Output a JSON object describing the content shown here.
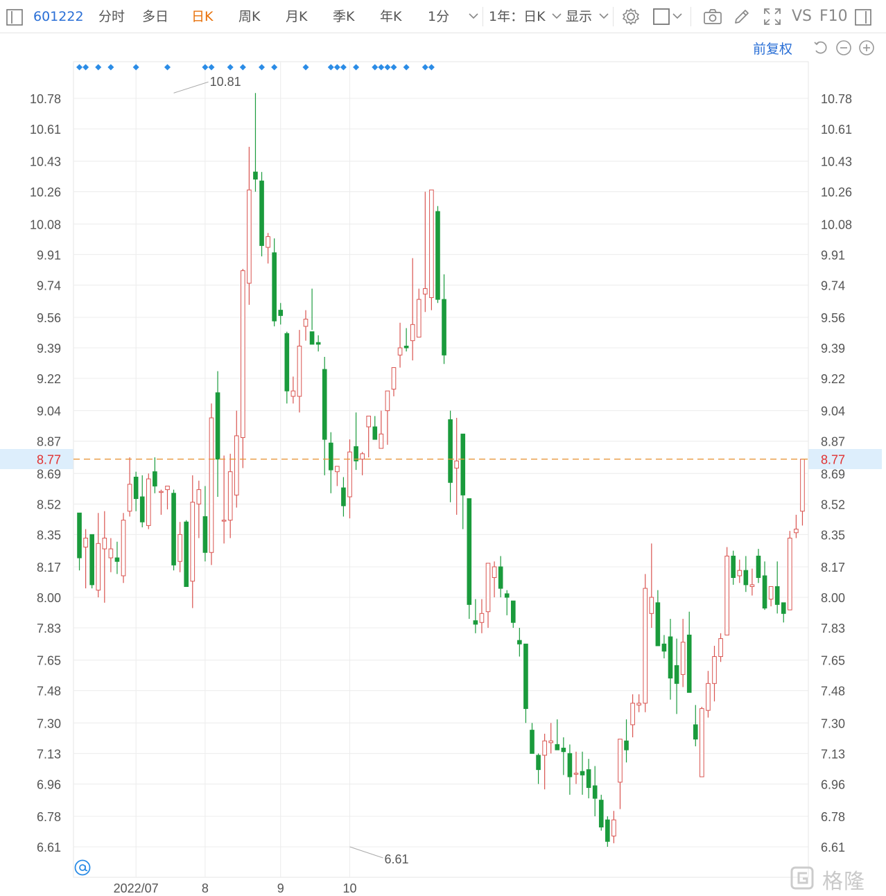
{
  "toolbar": {
    "code": "601222",
    "periods": [
      "分时",
      "多日",
      "日K",
      "周K",
      "月K",
      "季K",
      "年K",
      "1分"
    ],
    "active_period": "日K",
    "range_label": "1年：日K",
    "display_label": "显示",
    "vs_label": "VS",
    "f10_label": "F10"
  },
  "subbar": {
    "adjust_label": "前复权"
  },
  "watermark": "格隆汇",
  "icons": {
    "sidebar-toggle": "sidebar-icon",
    "settings": "gear-icon",
    "box": "square-icon",
    "camera": "camera-icon",
    "draw": "pencil-icon",
    "fullscreen": "fullscreen-icon",
    "panel": "panel-icon",
    "undo": "undo-icon",
    "zoom_out": "zoom-out-icon",
    "zoom_in": "zoom-in-icon",
    "at": "at-icon"
  },
  "colors": {
    "up": "#d9534f",
    "down": "#1a9b3c",
    "current_line": "#e8963a",
    "current_text": "#e03030",
    "marker": "#2b8ce6",
    "accent": "#e8710a",
    "link": "#2a6fd6"
  },
  "chart_data": {
    "type": "candlestick",
    "yticks": [
      "10.78",
      "10.61",
      "10.43",
      "10.26",
      "10.08",
      "9.91",
      "9.74",
      "9.56",
      "9.39",
      "9.22",
      "9.04",
      "8.87",
      "8.69",
      "8.52",
      "8.35",
      "8.17",
      "8.00",
      "7.83",
      "7.65",
      "7.48",
      "7.30",
      "7.13",
      "6.96",
      "6.78",
      "6.61"
    ],
    "ylim": [
      6.61,
      10.78
    ],
    "x_labels": [
      {
        "label": "2022/07",
        "index": 9
      },
      {
        "label": "8",
        "index": 20
      },
      {
        "label": "9",
        "index": 32
      },
      {
        "label": "10",
        "index": 43
      }
    ],
    "current_price": 8.77,
    "annotations": [
      {
        "label": "10.81",
        "index": 15,
        "price": 10.81
      },
      {
        "label": "6.61",
        "index": 43,
        "price": 6.61
      }
    ],
    "marker_indices": [
      0,
      1,
      3,
      5,
      9,
      14,
      20,
      21,
      24,
      26,
      29,
      31,
      36,
      40,
      41,
      42,
      44,
      47,
      48,
      49,
      50,
      52,
      55,
      56
    ],
    "candles": [
      {
        "o": 8.47,
        "h": 8.47,
        "l": 8.15,
        "c": 8.22
      },
      {
        "o": 8.28,
        "h": 8.38,
        "l": 8.05,
        "c": 8.33
      },
      {
        "o": 8.35,
        "h": 8.35,
        "l": 8.05,
        "c": 8.07
      },
      {
        "o": 8.04,
        "h": 8.47,
        "l": 8.0,
        "c": 8.3
      },
      {
        "o": 8.27,
        "h": 8.48,
        "l": 7.97,
        "c": 8.33
      },
      {
        "o": 8.22,
        "h": 8.33,
        "l": 8.14,
        "c": 8.27
      },
      {
        "o": 8.22,
        "h": 8.31,
        "l": 8.13,
        "c": 8.2
      },
      {
        "o": 8.12,
        "h": 8.47,
        "l": 8.08,
        "c": 8.43
      },
      {
        "o": 8.48,
        "h": 8.78,
        "l": 8.45,
        "c": 8.63
      },
      {
        "o": 8.67,
        "h": 8.7,
        "l": 8.48,
        "c": 8.55
      },
      {
        "o": 8.56,
        "h": 8.68,
        "l": 8.39,
        "c": 8.42
      },
      {
        "o": 8.4,
        "h": 8.69,
        "l": 8.38,
        "c": 8.66
      },
      {
        "o": 8.7,
        "h": 8.78,
        "l": 8.58,
        "c": 8.62
      },
      {
        "o": 8.59,
        "h": 8.6,
        "l": 8.46,
        "c": 8.59
      },
      {
        "o": 8.6,
        "h": 8.62,
        "l": 8.49,
        "c": 8.62
      },
      {
        "o": 8.58,
        "h": 8.6,
        "l": 8.15,
        "c": 8.18
      },
      {
        "o": 8.2,
        "h": 8.42,
        "l": 8.14,
        "c": 8.35
      },
      {
        "o": 8.42,
        "h": 8.43,
        "l": 8.06,
        "c": 8.06
      },
      {
        "o": 8.09,
        "h": 8.68,
        "l": 7.94,
        "c": 8.53
      },
      {
        "o": 8.52,
        "h": 8.65,
        "l": 8.33,
        "c": 8.6
      },
      {
        "o": 8.45,
        "h": 8.62,
        "l": 8.2,
        "c": 8.25
      },
      {
        "o": 8.25,
        "h": 9.08,
        "l": 8.18,
        "c": 9.0
      },
      {
        "o": 9.14,
        "h": 9.26,
        "l": 8.56,
        "c": 8.77
      },
      {
        "o": 8.43,
        "h": 8.79,
        "l": 8.3,
        "c": 8.43
      },
      {
        "o": 8.43,
        "h": 8.8,
        "l": 8.33,
        "c": 8.7
      },
      {
        "o": 8.57,
        "h": 9.04,
        "l": 8.5,
        "c": 8.9
      },
      {
        "o": 8.89,
        "h": 9.83,
        "l": 8.72,
        "c": 9.82
      },
      {
        "o": 9.75,
        "h": 10.51,
        "l": 9.63,
        "c": 10.27
      },
      {
        "o": 10.37,
        "h": 10.81,
        "l": 10.26,
        "c": 10.33
      },
      {
        "o": 10.32,
        "h": 10.37,
        "l": 9.9,
        "c": 9.96
      },
      {
        "o": 9.95,
        "h": 10.03,
        "l": 9.86,
        "c": 10.01
      },
      {
        "o": 9.92,
        "h": 10.0,
        "l": 9.51,
        "c": 9.54
      },
      {
        "o": 9.6,
        "h": 9.64,
        "l": 9.52,
        "c": 9.57
      },
      {
        "o": 9.47,
        "h": 9.48,
        "l": 9.08,
        "c": 9.15
      },
      {
        "o": 9.12,
        "h": 9.23,
        "l": 9.08,
        "c": 9.15
      },
      {
        "o": 9.12,
        "h": 9.49,
        "l": 9.03,
        "c": 9.4
      },
      {
        "o": 9.51,
        "h": 9.6,
        "l": 9.43,
        "c": 9.55
      },
      {
        "o": 9.48,
        "h": 9.72,
        "l": 9.49,
        "c": 9.41
      },
      {
        "o": 9.42,
        "h": 9.46,
        "l": 9.37,
        "c": 9.41
      },
      {
        "o": 9.27,
        "h": 9.34,
        "l": 8.68,
        "c": 8.88
      },
      {
        "o": 8.86,
        "h": 8.92,
        "l": 8.58,
        "c": 8.71
      },
      {
        "o": 8.7,
        "h": 8.73,
        "l": 8.62,
        "c": 8.73
      },
      {
        "o": 8.61,
        "h": 8.67,
        "l": 8.45,
        "c": 8.51
      },
      {
        "o": 8.56,
        "h": 8.88,
        "l": 8.44,
        "c": 8.81
      },
      {
        "o": 8.84,
        "h": 9.03,
        "l": 8.71,
        "c": 8.76
      },
      {
        "o": 8.77,
        "h": 8.81,
        "l": 8.68,
        "c": 8.8
      },
      {
        "o": 8.95,
        "h": 8.99,
        "l": 8.78,
        "c": 9.01
      },
      {
        "o": 8.95,
        "h": 9.01,
        "l": 8.93,
        "c": 8.88
      },
      {
        "o": 8.83,
        "h": 9.04,
        "l": 8.83,
        "c": 8.91
      },
      {
        "o": 9.04,
        "h": 9.12,
        "l": 8.85,
        "c": 9.15
      },
      {
        "o": 9.16,
        "h": 9.22,
        "l": 9.12,
        "c": 9.28
      },
      {
        "o": 9.35,
        "h": 9.53,
        "l": 9.28,
        "c": 9.39
      },
      {
        "o": 9.4,
        "h": 9.5,
        "l": 9.37,
        "c": 9.39
      },
      {
        "o": 9.43,
        "h": 9.89,
        "l": 9.32,
        "c": 9.52
      },
      {
        "o": 9.45,
        "h": 9.72,
        "l": 9.45,
        "c": 9.66
      },
      {
        "o": 9.69,
        "h": 10.26,
        "l": 9.59,
        "c": 9.72
      },
      {
        "o": 9.67,
        "h": 10.27,
        "l": 9.6,
        "c": 10.27
      },
      {
        "o": 10.15,
        "h": 10.18,
        "l": 9.64,
        "c": 9.66
      },
      {
        "o": 9.66,
        "h": 9.8,
        "l": 9.3,
        "c": 9.35
      },
      {
        "o": 8.99,
        "h": 9.04,
        "l": 8.53,
        "c": 8.64
      },
      {
        "o": 8.72,
        "h": 9.0,
        "l": 8.46,
        "c": 8.76
      },
      {
        "o": 8.91,
        "h": 8.91,
        "l": 8.38,
        "c": 8.57
      },
      {
        "o": 8.55,
        "h": 8.55,
        "l": 7.88,
        "c": 7.96
      },
      {
        "o": 7.87,
        "h": 7.99,
        "l": 7.8,
        "c": 7.85
      },
      {
        "o": 7.86,
        "h": 7.99,
        "l": 7.8,
        "c": 7.91
      },
      {
        "o": 7.92,
        "h": 8.19,
        "l": 7.83,
        "c": 8.19
      },
      {
        "o": 8.11,
        "h": 8.2,
        "l": 8.0,
        "c": 8.17
      },
      {
        "o": 8.17,
        "h": 8.23,
        "l": 8.0,
        "c": 8.05
      },
      {
        "o": 8.02,
        "h": 8.04,
        "l": 7.9,
        "c": 8.0
      },
      {
        "o": 7.98,
        "h": 7.98,
        "l": 7.83,
        "c": 7.86
      },
      {
        "o": 7.76,
        "h": 7.83,
        "l": 7.67,
        "c": 7.74
      },
      {
        "o": 7.74,
        "h": 7.74,
        "l": 7.3,
        "c": 7.38
      },
      {
        "o": 7.26,
        "h": 7.3,
        "l": 7.14,
        "c": 7.13
      },
      {
        "o": 7.12,
        "h": 7.13,
        "l": 6.96,
        "c": 7.04
      },
      {
        "o": 7.12,
        "h": 7.24,
        "l": 6.93,
        "c": 7.2
      },
      {
        "o": 7.19,
        "h": 7.3,
        "l": 7.13,
        "c": 7.2
      },
      {
        "o": 7.18,
        "h": 7.32,
        "l": 7.16,
        "c": 7.15
      },
      {
        "o": 7.16,
        "h": 7.22,
        "l": 7.01,
        "c": 7.14
      },
      {
        "o": 7.13,
        "h": 7.18,
        "l": 6.9,
        "c": 7.0
      },
      {
        "o": 7.02,
        "h": 7.14,
        "l": 6.96,
        "c": 7.02
      },
      {
        "o": 7.03,
        "h": 7.14,
        "l": 6.9,
        "c": 7.01
      },
      {
        "o": 7.04,
        "h": 7.1,
        "l": 6.88,
        "c": 6.94
      },
      {
        "o": 6.95,
        "h": 7.06,
        "l": 6.78,
        "c": 6.88
      },
      {
        "o": 6.87,
        "h": 6.9,
        "l": 6.7,
        "c": 6.72
      },
      {
        "o": 6.76,
        "h": 6.78,
        "l": 6.61,
        "c": 6.64
      },
      {
        "o": 6.67,
        "h": 6.81,
        "l": 6.63,
        "c": 6.76
      },
      {
        "o": 6.97,
        "h": 7.19,
        "l": 6.82,
        "c": 7.21
      },
      {
        "o": 7.2,
        "h": 7.32,
        "l": 7.08,
        "c": 7.15
      },
      {
        "o": 7.29,
        "h": 7.46,
        "l": 7.22,
        "c": 7.41
      },
      {
        "o": 7.4,
        "h": 7.46,
        "l": 7.36,
        "c": 7.41
      },
      {
        "o": 7.41,
        "h": 8.13,
        "l": 7.36,
        "c": 8.05
      },
      {
        "o": 7.91,
        "h": 8.3,
        "l": 7.83,
        "c": 8.0
      },
      {
        "o": 7.97,
        "h": 8.04,
        "l": 7.76,
        "c": 7.73
      },
      {
        "o": 7.74,
        "h": 7.79,
        "l": 7.66,
        "c": 7.7
      },
      {
        "o": 7.78,
        "h": 7.88,
        "l": 7.43,
        "c": 7.55
      },
      {
        "o": 7.62,
        "h": 7.77,
        "l": 7.35,
        "c": 7.52
      },
      {
        "o": 7.57,
        "h": 7.88,
        "l": 7.5,
        "c": 7.75
      },
      {
        "o": 7.79,
        "h": 7.92,
        "l": 7.52,
        "c": 7.47
      },
      {
        "o": 7.29,
        "h": 7.4,
        "l": 7.17,
        "c": 7.21
      },
      {
        "o": 7.0,
        "h": 7.39,
        "l": 7.0,
        "c": 7.38
      },
      {
        "o": 7.37,
        "h": 7.59,
        "l": 7.33,
        "c": 7.52
      },
      {
        "o": 7.52,
        "h": 7.73,
        "l": 7.42,
        "c": 7.67
      },
      {
        "o": 7.67,
        "h": 7.8,
        "l": 7.64,
        "c": 7.77
      },
      {
        "o": 7.79,
        "h": 8.28,
        "l": 7.79,
        "c": 8.23
      },
      {
        "o": 8.23,
        "h": 8.26,
        "l": 8.07,
        "c": 8.11
      },
      {
        "o": 8.12,
        "h": 8.21,
        "l": 8.08,
        "c": 8.15
      },
      {
        "o": 8.15,
        "h": 8.23,
        "l": 8.03,
        "c": 8.07
      },
      {
        "o": 8.06,
        "h": 8.16,
        "l": 8.01,
        "c": 8.07
      },
      {
        "o": 8.23,
        "h": 8.27,
        "l": 8.08,
        "c": 8.11
      },
      {
        "o": 8.12,
        "h": 8.2,
        "l": 7.93,
        "c": 7.94
      },
      {
        "o": 7.99,
        "h": 8.06,
        "l": 7.95,
        "c": 8.06
      },
      {
        "o": 8.06,
        "h": 8.2,
        "l": 7.91,
        "c": 7.96
      },
      {
        "o": 7.97,
        "h": 7.96,
        "l": 7.86,
        "c": 7.91
      },
      {
        "o": 7.93,
        "h": 8.37,
        "l": 7.93,
        "c": 8.33
      },
      {
        "o": 8.36,
        "h": 8.46,
        "l": 8.33,
        "c": 8.38
      },
      {
        "o": 8.48,
        "h": 8.77,
        "l": 8.4,
        "c": 8.77
      }
    ]
  }
}
